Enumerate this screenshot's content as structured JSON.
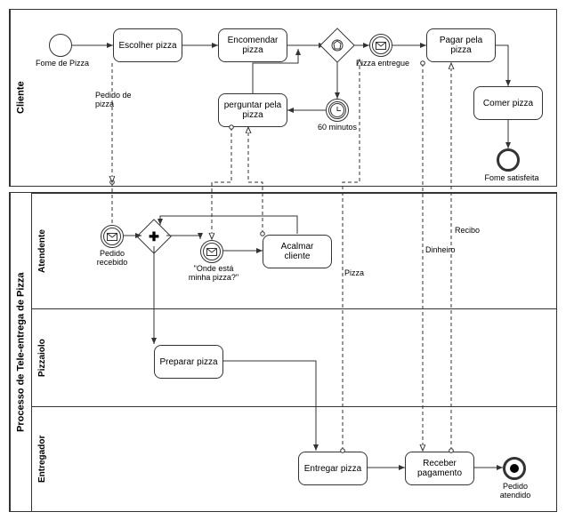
{
  "pool1": {
    "name": "Cliente",
    "start": {
      "label": "Fome de Pizza"
    },
    "tasks": {
      "escolher": "Escolher pizza",
      "encomendar": "Encomendar pizza",
      "perguntar": "perguntar pela pizza",
      "pagar": "Pagar pela pizza",
      "comer": "Comer pizza"
    },
    "events": {
      "timer": "60 minutos",
      "entregue": "Pizza entregue",
      "end": "Fome satisfeita"
    },
    "msg": {
      "pedido": "Pedido de\npizza"
    }
  },
  "pool2": {
    "name": "Processo de Tele-entrega de Pizza",
    "lanes": {
      "atendente": "Atendente",
      "pizzaiolo": "Pizzaiolo",
      "entregador": "Entregador"
    },
    "events": {
      "recebido": "Pedido\nrecebido",
      "onde": "\"Onde está\nminha pizza?\"",
      "end": "Pedido\natendido"
    },
    "tasks": {
      "acalmar": "Acalmar cliente",
      "preparar": "Preparar pizza",
      "entregar": "Entregar pizza",
      "receber": "Receber pagamento"
    },
    "msg": {
      "pizza": "Pizza",
      "dinheiro": "Dinheiro",
      "recibo": "Recibo"
    }
  }
}
